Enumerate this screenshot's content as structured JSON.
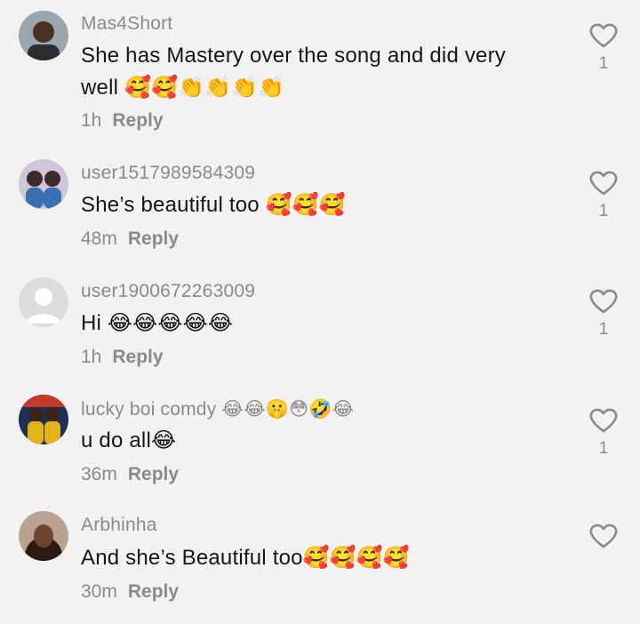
{
  "comments": [
    {
      "username": "Mas4Short",
      "text": "She has Mastery over the song and did very well 🥰🥰👏👏👏👏",
      "time": "1h",
      "reply": "Reply",
      "likes": "1",
      "avatar_color": "#6b4a2e"
    },
    {
      "username": "user1517989584309",
      "text": "She’s beautiful too 🥰🥰🥰",
      "time": "48m",
      "reply": "Reply",
      "likes": "1",
      "avatar_color": "#7a5f8a"
    },
    {
      "username": "user1900672263009",
      "text": "Hi 😂😂😂😂😂",
      "time": "1h",
      "reply": "Reply",
      "likes": "1",
      "avatar_color": "#d9d9d9"
    },
    {
      "username": "lucky boi comdy 😂😂🤫😳🤣😂",
      "text": "u do all😂",
      "time": "36m",
      "reply": "Reply",
      "likes": "1",
      "avatar_color": "#e1b21a"
    },
    {
      "username": "Arbhinha",
      "text": "And she’s Beautiful too🥰🥰🥰🥰",
      "time": "30m",
      "reply": "Reply",
      "likes": "",
      "avatar_color": "#5a3b2c"
    }
  ]
}
